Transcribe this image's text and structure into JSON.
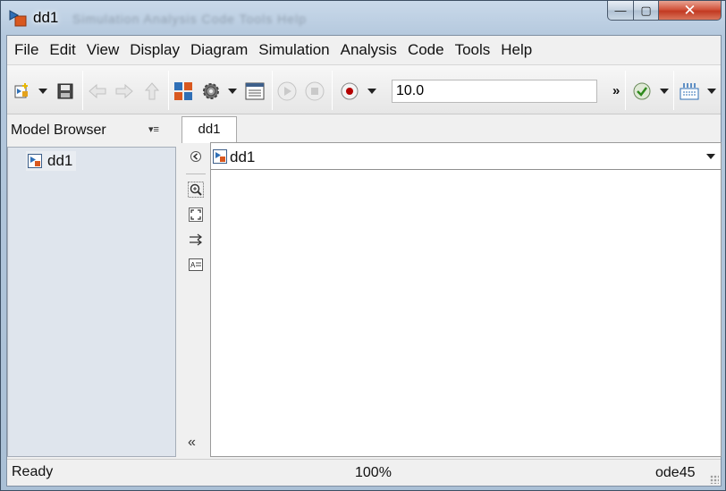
{
  "window": {
    "title": "dd1",
    "title_ghost": "Simulation Analysis Code Tools Help",
    "controls": {
      "minimize_glyph": "—",
      "maximize_glyph": "▢",
      "close_glyph": "✕"
    }
  },
  "menubar": {
    "items": [
      "File",
      "Edit",
      "View",
      "Display",
      "Diagram",
      "Simulation",
      "Analysis",
      "Code",
      "Tools",
      "Help"
    ]
  },
  "toolbar": {
    "stop_time": "10.0",
    "more_glyph": "»",
    "icons": [
      "new-model-icon",
      "save-icon",
      "back-icon",
      "forward-icon",
      "up-icon",
      "library-browser-icon",
      "model-settings-icon",
      "model-explorer-icon",
      "run-icon",
      "stop-icon",
      "record-icon",
      "check-icon",
      "build-icon"
    ]
  },
  "model_browser": {
    "title": "Model Browser",
    "menu_glyph": "▾≡",
    "items": [
      {
        "label": "dd1",
        "icon": "simulink-model-icon"
      }
    ]
  },
  "tabs": [
    {
      "label": "dd1"
    }
  ],
  "editor": {
    "address": "dd1",
    "palette_icons": [
      "hide-show-icon",
      "zoom-icon",
      "fit-view-icon",
      "route-lines-icon",
      "annotation-icon"
    ],
    "collapse_glyph": "«"
  },
  "status": {
    "state": "Ready",
    "zoom": "100%",
    "solver": "ode45"
  },
  "colors": {
    "accent": "#c23a22",
    "panel_bg": "#dfe5ed",
    "chrome_bg": "#f0f0f0"
  }
}
